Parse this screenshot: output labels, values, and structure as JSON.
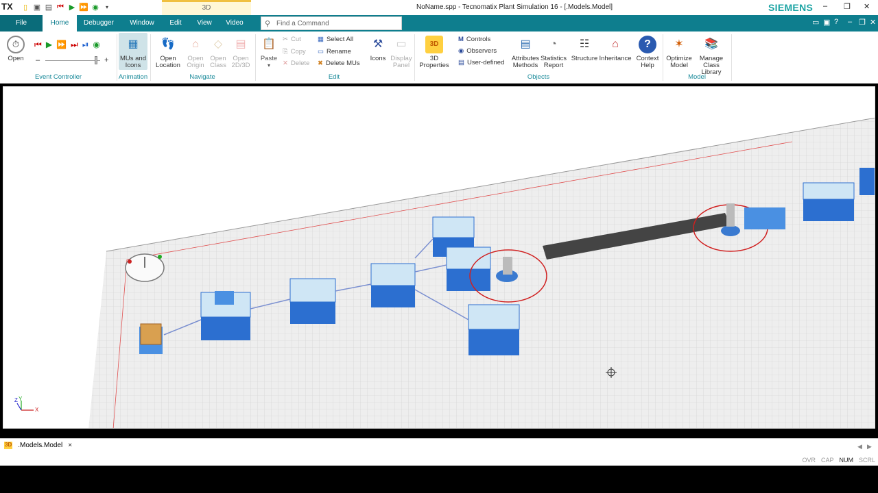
{
  "titlebar": {
    "logo": "TX",
    "center_tab": "3D",
    "window_title": "NoName.spp - Tecnomatix Plant Simulation 16 - [.Models.Model]",
    "brand": "SIEMENS"
  },
  "menu": {
    "file": "File",
    "tabs": [
      "Home",
      "Debugger",
      "Window",
      "Edit",
      "View",
      "Video"
    ],
    "search_placeholder": "Find a Command"
  },
  "ribbon": {
    "event_controller": {
      "open": "Open",
      "group": "Event Controller",
      "minus": "–",
      "plus": "+"
    },
    "animation": {
      "mus_icons": [
        "MUs and",
        "Icons"
      ],
      "group": "Animation"
    },
    "navigate": {
      "open_location": [
        "Open",
        "Location"
      ],
      "open_origin": [
        "Open",
        "Origin"
      ],
      "open_class": [
        "Open",
        "Class"
      ],
      "open_2d3d": [
        "Open",
        "2D/3D"
      ],
      "group": "Navigate"
    },
    "edit": {
      "paste": "Paste",
      "cut": "Cut",
      "copy": "Copy",
      "delete": "Delete",
      "select_all": "Select All",
      "rename": "Rename",
      "delete_mus": "Delete MUs",
      "icons": "Icons",
      "display_panel": [
        "Display",
        "Panel"
      ],
      "group": "Edit"
    },
    "objects": {
      "properties_3d": [
        "3D",
        "Properties"
      ],
      "controls": "Controls",
      "observers": "Observers",
      "user_defined": "User-defined",
      "attributes_methods": [
        "Attributes",
        "Methods"
      ],
      "statistics_report": [
        "Statistics",
        "Report"
      ],
      "structure": "Structure",
      "inheritance": "Inheritance",
      "context_help": [
        "Context",
        "Help"
      ],
      "group": "Objects"
    },
    "model": {
      "optimize_model": [
        "Optimize",
        "Model"
      ],
      "manage_class_library": [
        "Manage",
        "Class Library"
      ],
      "group": "Model"
    }
  },
  "viewport": {
    "axis_y": "Y",
    "axis_z": "Z",
    "axis_x": "X"
  },
  "document_tab": {
    "icon": "3D",
    "label": ".Models.Model",
    "close": "×"
  },
  "status": {
    "items": [
      "OVR",
      "CAP",
      "NUM",
      "SCRL"
    ],
    "active": "NUM"
  }
}
